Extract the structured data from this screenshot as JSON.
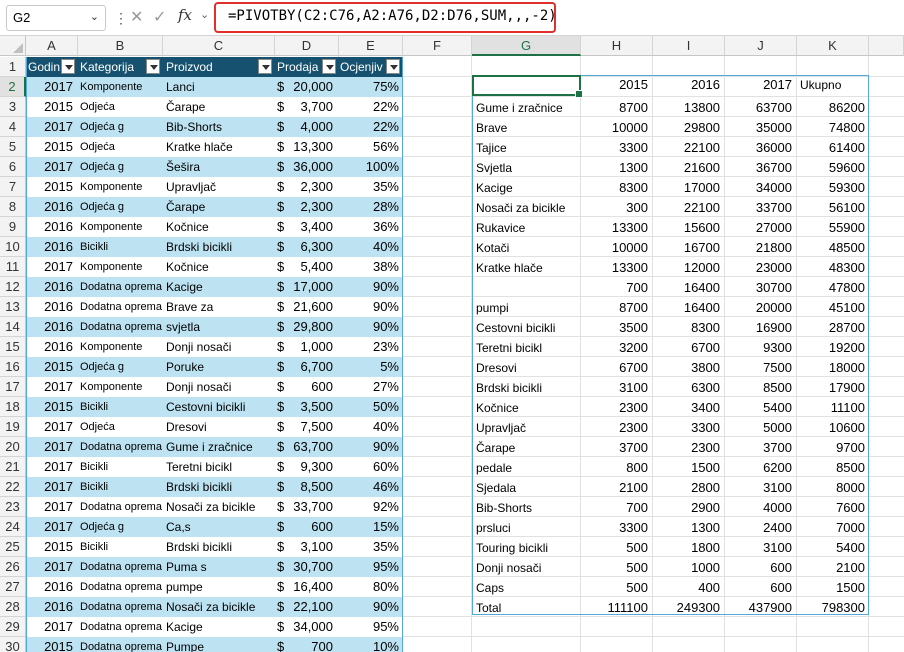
{
  "formula_bar": {
    "name_box": "G2",
    "formula": "=PIVOTBY(C2:C76,A2:A76,D2:D76,SUM,,,-2)",
    "fx_label": "fx"
  },
  "columns": [
    "A",
    "B",
    "C",
    "D",
    "E",
    "F",
    "G",
    "H",
    "I",
    "J",
    "K"
  ],
  "rows": [
    "1",
    "2",
    "3",
    "4",
    "5",
    "6",
    "7",
    "8",
    "9",
    "10",
    "11",
    "12",
    "13",
    "14",
    "15",
    "16",
    "17",
    "18",
    "19",
    "20",
    "21",
    "22",
    "23",
    "24",
    "25",
    "26",
    "27",
    "28",
    "29",
    "30"
  ],
  "table": {
    "headers": [
      "Godin",
      "Kategorija",
      "Proizvod",
      "Prodaja",
      "Ocjenjiv"
    ],
    "rows": [
      [
        "2017",
        "Komponente",
        "Lanci",
        "$",
        "20,000",
        "75%"
      ],
      [
        "2015",
        "Odjeća",
        "Čarape",
        "$",
        "3,700",
        "22%"
      ],
      [
        "2017",
        "Odjeća      g",
        "Bib-Shorts",
        "$",
        "4,000",
        "22%"
      ],
      [
        "2015",
        "Odjeća",
        "Kratke hlače",
        "$",
        "13,300",
        "56%"
      ],
      [
        "2017",
        "Odjeća      g",
        "Šešira",
        "$",
        "36,000",
        "100%"
      ],
      [
        "2015",
        "Komponente",
        "Upravljač",
        "$",
        "2,300",
        "35%"
      ],
      [
        "2016",
        "Odjeća      g",
        "Čarape",
        "$",
        "2,300",
        "28%"
      ],
      [
        "2016",
        "Komponente",
        "Kočnice",
        "$",
        "3,400",
        "36%"
      ],
      [
        "2016",
        "Bicikli",
        "Brdski bicikli",
        "$",
        "6,300",
        "40%"
      ],
      [
        "2017",
        "Komponente",
        "Kočnice",
        "$",
        "5,400",
        "38%"
      ],
      [
        "2016",
        "Dodatna oprema",
        "Kacige",
        "$",
        "17,000",
        "90%"
      ],
      [
        "2016",
        "Dodatna oprema",
        "Brave za",
        "$",
        "21,600",
        "90%"
      ],
      [
        "2016",
        "Dodatna oprema",
        "svjetla",
        "$",
        "29,800",
        "90%"
      ],
      [
        "2016",
        "Komponente",
        "Donji nosači",
        "$",
        "1,000",
        "23%"
      ],
      [
        "2015",
        "Odjeća      g",
        "Poruke",
        "$",
        "6,700",
        "5%"
      ],
      [
        "2017",
        "Komponente",
        "Donji nosači",
        "$",
        "600",
        "27%"
      ],
      [
        "2015",
        "Bicikli",
        "Cestovni bicikli",
        "$",
        "3,500",
        "50%"
      ],
      [
        "2017",
        "Odjeća",
        "Dresovi",
        "$",
        "7,500",
        "40%"
      ],
      [
        "2017",
        "Dodatna oprema",
        "Gume i zračnice",
        "$",
        "63,700",
        "90%"
      ],
      [
        "2017",
        "Bicikli",
        "Teretni bicikl",
        "$",
        "9,300",
        "60%"
      ],
      [
        "2017",
        "Bicikli",
        "Brdski bicikli",
        "$",
        "8,500",
        "46%"
      ],
      [
        "2017",
        "Dodatna oprema",
        "Nosači za bicikle",
        "$",
        "33,700",
        "92%"
      ],
      [
        "2017",
        "Odjeća      g",
        "Ca,s",
        "$",
        "600",
        "15%"
      ],
      [
        "2015",
        "Bicikli",
        "Brdski bicikli",
        "$",
        "3,100",
        "35%"
      ],
      [
        "2017",
        "Dodatna oprema",
        "Puma s",
        "$",
        "30,700",
        "95%"
      ],
      [
        "2016",
        "Dodatna oprema",
        "pumpe",
        "$",
        "16,400",
        "80%"
      ],
      [
        "2016",
        "Dodatna oprema",
        "Nosači za bicikle",
        "$",
        "22,100",
        "90%"
      ],
      [
        "2017",
        "Dodatna oprema",
        "Kacige",
        "$",
        "34,000",
        "95%"
      ],
      [
        "2015",
        "Dodatna oprema",
        "Pumpe",
        "$",
        "700",
        "10%"
      ]
    ]
  },
  "pivot": {
    "header": [
      "",
      "2015",
      "2016",
      "2017",
      "Ukupno"
    ],
    "rows": [
      [
        "Gume i zračnice",
        "8700",
        "13800",
        "63700",
        "86200"
      ],
      [
        " Brave",
        "10000",
        "29800",
        "35000",
        "74800"
      ],
      [
        " Tajice",
        "3300",
        "22100",
        "36000",
        "61400"
      ],
      [
        " Svjetla",
        "1300",
        "21600",
        "36700",
        "59600"
      ],
      [
        " Kacige",
        "8300",
        "17000",
        "34000",
        "59300"
      ],
      [
        " Nosači za bicikle",
        "300",
        "22100",
        "33700",
        "56100"
      ],
      [
        "Rukavice",
        "13300",
        "15600",
        "27000",
        "55900"
      ],
      [
        "   Kotači",
        "10000",
        "16700",
        "21800",
        "48500"
      ],
      [
        " Kratke hlače",
        "13300",
        "12000",
        "23000",
        "48300"
      ],
      [
        "",
        "700",
        "16400",
        "30700",
        "47800"
      ],
      [
        "   pumpi",
        "8700",
        "16400",
        "20000",
        "45100"
      ],
      [
        "Cestovni bicikli",
        "3500",
        "8300",
        "16900",
        "28700"
      ],
      [
        " Teretni bicikl",
        "3200",
        "6700",
        "9300",
        "19200"
      ],
      [
        " Dresovi",
        "6700",
        "3800",
        "7500",
        "18000"
      ],
      [
        " Brdski bicikli",
        "3100",
        "6300",
        "8500",
        "17900"
      ],
      [
        " Kočnice",
        "2300",
        "3400",
        "5400",
        "11100"
      ],
      [
        " Upravljač",
        "2300",
        "3300",
        "5000",
        "10600"
      ],
      [
        " Čarape",
        "3700",
        "2300",
        "3700",
        "9700"
      ],
      [
        " pedale",
        "800",
        "1500",
        "6200",
        "8500"
      ],
      [
        " Sjedala",
        "2100",
        "2800",
        "3100",
        "8000"
      ],
      [
        " Bib-Shorts",
        "700",
        "2900",
        "4000",
        "7600"
      ],
      [
        " prsluci",
        "3300",
        "1300",
        "2400",
        "7000"
      ],
      [
        " Touring bicikli",
        "500",
        "1800",
        "3100",
        "5400"
      ],
      [
        " Donji nosači",
        "500",
        "1000",
        "600",
        "2100"
      ],
      [
        " Caps",
        "500",
        "400",
        "600",
        "1500"
      ],
      [
        " Total",
        "111100",
        "249300",
        "437900",
        "798300"
      ]
    ]
  },
  "colors": {
    "header_fill": "#16526f",
    "band_fill": "#bde3f2",
    "selection": "#1e7145",
    "formula_highlight": "#e0302e"
  }
}
